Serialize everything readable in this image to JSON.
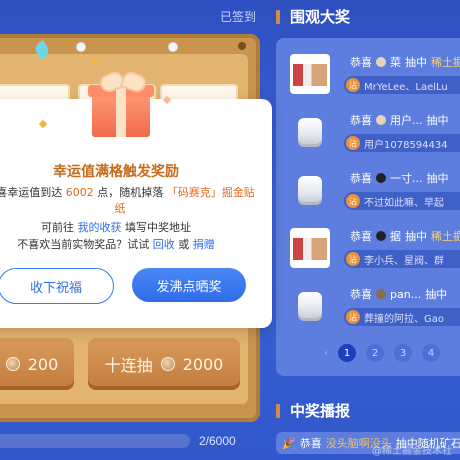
{
  "header": {
    "signed_label": "已签到"
  },
  "draw": {
    "single_cost": "200",
    "ten_label": "十连抽",
    "ten_cost": "2000",
    "progress_text": "2/6000",
    "progress_fraction": 0.0003
  },
  "winners": {
    "title": "围观大奖",
    "items": [
      {
        "congrats": "恭喜",
        "user": "菜",
        "action": "抽中",
        "prize": "稀土掘",
        "likes": "MrYeLee、LaelLu",
        "image": "photo"
      },
      {
        "congrats": "恭喜",
        "user": "用户...",
        "action": "抽中",
        "prize": "",
        "likes": "用户1078594434",
        "image": "cube"
      },
      {
        "congrats": "恭喜",
        "user": "一寸...",
        "action": "抽中",
        "prize": "",
        "likes": "不过如此嘛、早起",
        "image": "cube"
      },
      {
        "congrats": "恭喜",
        "user": "据",
        "action": "抽中",
        "prize": "稀土掘",
        "likes": "李小兵、星阀、群",
        "image": "photo"
      },
      {
        "congrats": "恭喜",
        "user": "pan...",
        "action": "抽中",
        "prize": "",
        "likes": "葬撞的阿拉、Gao",
        "image": "cube"
      }
    ],
    "like_badge": "沾",
    "pages": [
      "1",
      "2",
      "3",
      "4"
    ],
    "active_page": "1",
    "prev_arrow": "‹"
  },
  "broadcast": {
    "title": "中奖播报",
    "congrats": "恭喜",
    "user": "没头脑啊没头",
    "text": "抽中随机矿石"
  },
  "watermark": "@稀土掘金技术社区",
  "modal": {
    "title": "幸运值满格触发奖励",
    "body_prefix": "恭喜幸运值到达",
    "body_value": "6002",
    "body_mid": "点，随机掉落",
    "body_prize": "「码赛克」掘金贴纸",
    "line2_prefix": "可前往",
    "line2_link": "我的收获",
    "line2_suffix": "填写中奖地址",
    "line3_prefix": "不喜欢当前实物奖品？试试",
    "line3_link1": "回收",
    "line3_mid": "或",
    "line3_link2": "捐赠",
    "keep_button": "收下祝福",
    "share_button": "发沸点晒奖"
  },
  "colors": {
    "accent_orange": "#e26a20",
    "link_blue": "#2f6de8",
    "prize_gold": "#f6d37a",
    "background_blue": "#2f56c8"
  }
}
